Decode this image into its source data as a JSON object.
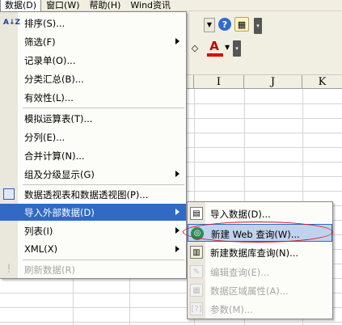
{
  "menubar": {
    "items": [
      "数据(D)",
      "窗口(W)",
      "帮助(H)",
      "Wind资讯"
    ]
  },
  "columns": [
    "I",
    "J",
    "K"
  ],
  "data_menu": {
    "items": [
      {
        "label": "排序(S)...",
        "icon": "sort-az-icon"
      },
      {
        "label": "筛选(F)",
        "submenu": true
      },
      {
        "label": "记录单(O)..."
      },
      {
        "label": "分类汇总(B)..."
      },
      {
        "label": "有效性(L)..."
      },
      {
        "label": "模拟运算表(T)..."
      },
      {
        "label": "分列(E)..."
      },
      {
        "label": "合并计算(N)..."
      },
      {
        "label": "组及分级显示(G)",
        "submenu": true
      },
      {
        "label": "数据透视表和数据透视图(P)...",
        "icon": "pivot-table-icon"
      },
      {
        "label": "导入外部数据(D)",
        "submenu": true,
        "highlighted": true
      },
      {
        "label": "列表(I)",
        "submenu": true
      },
      {
        "label": "XML(X)",
        "submenu": true
      },
      {
        "label": "刷新数据(R)",
        "icon": "refresh-icon",
        "disabled": true
      }
    ]
  },
  "sub_menu": {
    "items": [
      {
        "label": "导入数据(D)...",
        "icon": "import-data-icon"
      },
      {
        "label": "新建 Web 查询(W)...",
        "icon": "web-query-icon",
        "selected": true
      },
      {
        "label": "新建数据库查询(N)...",
        "icon": "database-query-icon"
      },
      {
        "label": "编辑查询(E)...",
        "icon": "edit-query-icon",
        "disabled": true
      },
      {
        "label": "数据区域属性(A)...",
        "icon": "range-properties-icon",
        "disabled": true
      },
      {
        "label": "参数(M)...",
        "icon": "parameters-icon",
        "disabled": true
      }
    ]
  },
  "colors": {
    "highlight": "#316ac5",
    "selection": "#c1d2ee",
    "annotation": "#d0101a"
  }
}
